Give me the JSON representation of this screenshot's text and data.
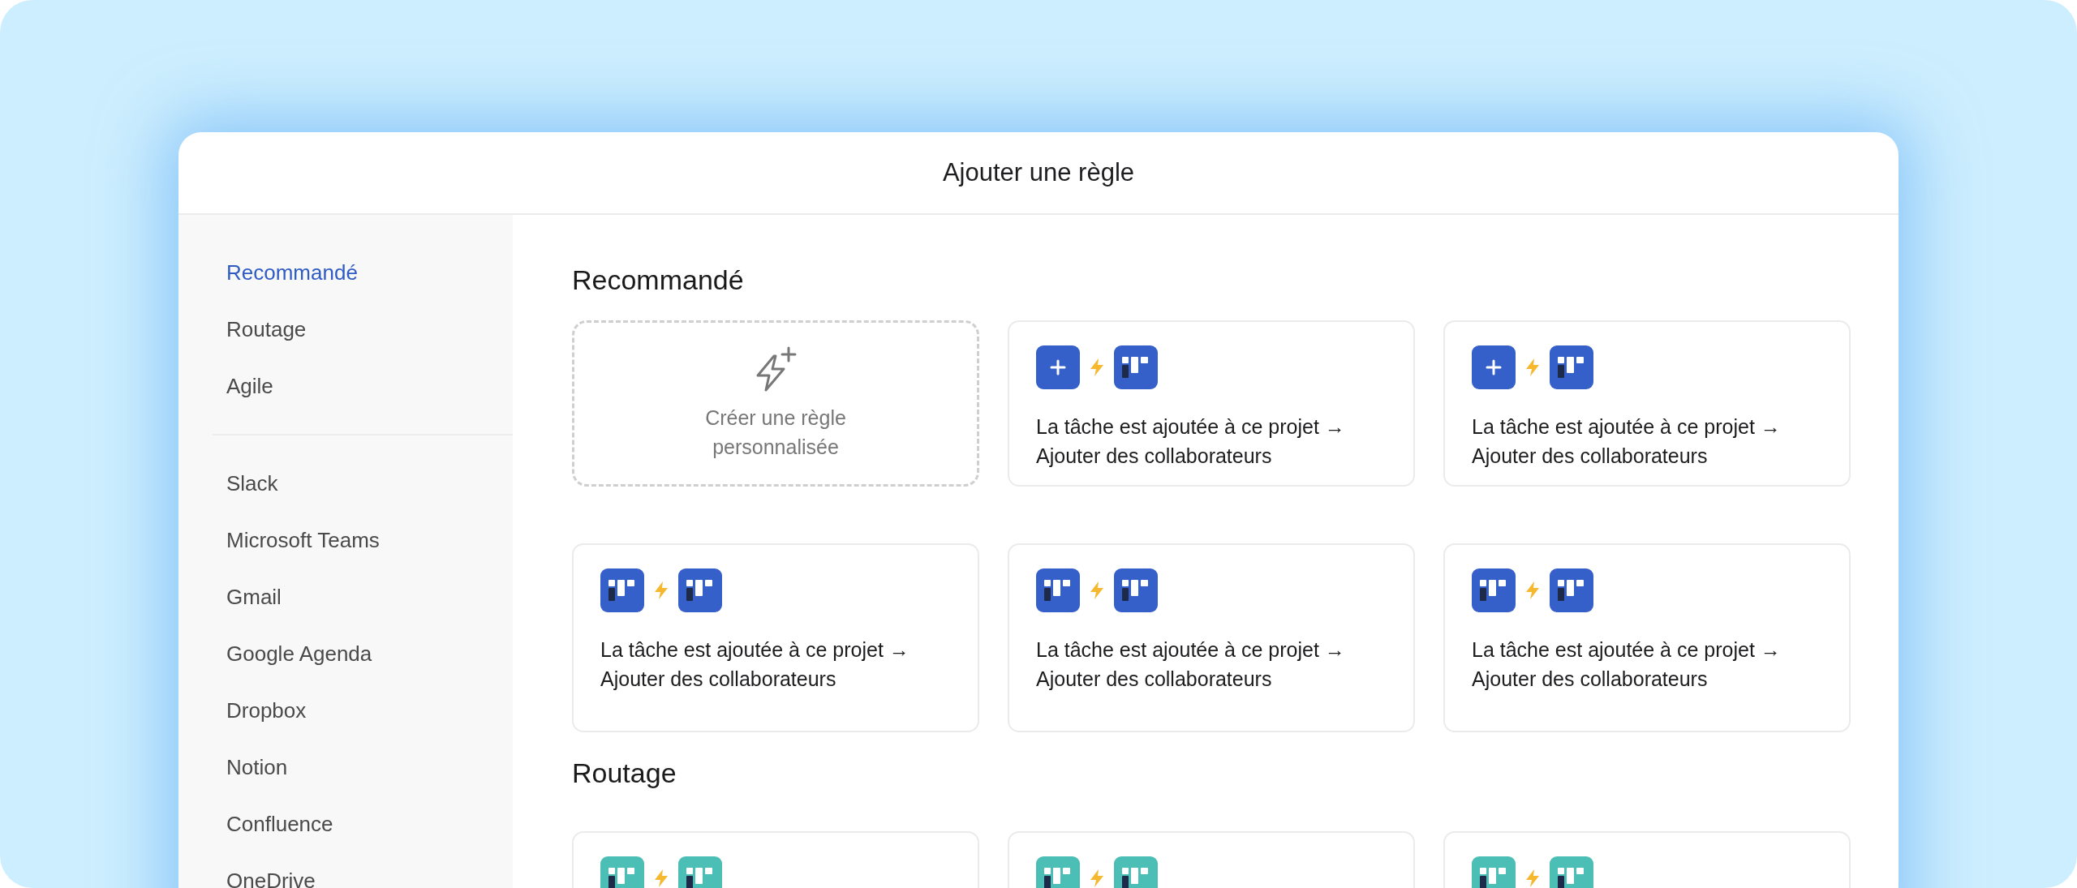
{
  "dialog": {
    "title": "Ajouter une règle"
  },
  "sidebar": {
    "groups": [
      {
        "items": [
          {
            "label": "Recommandé",
            "selected": true
          },
          {
            "label": "Routage",
            "selected": false
          },
          {
            "label": "Agile",
            "selected": false
          }
        ]
      },
      {
        "items": [
          {
            "label": "Slack",
            "selected": false
          },
          {
            "label": "Microsoft Teams",
            "selected": false
          },
          {
            "label": "Gmail",
            "selected": false
          },
          {
            "label": "Google Agenda",
            "selected": false
          },
          {
            "label": "Dropbox",
            "selected": false
          },
          {
            "label": "Notion",
            "selected": false
          },
          {
            "label": "Confluence",
            "selected": false
          },
          {
            "label": "OneDrive",
            "selected": false
          }
        ]
      }
    ]
  },
  "sections": [
    {
      "title": "Recommandé",
      "rows": [
        [
          {
            "kind": "custom",
            "label": "Créer une règle personnalisée"
          },
          {
            "kind": "rule",
            "icons": [
              {
                "kind": "plus"
              },
              {
                "kind": "board"
              }
            ],
            "color": "#3560c9",
            "trigger": "La tâche est ajoutée à ce projet →",
            "action": "Ajouter des collaborateurs"
          },
          {
            "kind": "rule",
            "icons": [
              {
                "kind": "plus"
              },
              {
                "kind": "board"
              }
            ],
            "color": "#3560c9",
            "trigger": "La tâche est ajoutée à ce projet →",
            "action": "Ajouter des collaborateurs"
          }
        ],
        [
          {
            "kind": "rule",
            "icons": [
              {
                "kind": "board"
              },
              {
                "kind": "board"
              }
            ],
            "color": "#3560c9",
            "trigger": "La tâche est ajoutée à ce projet →",
            "action": "Ajouter des collaborateurs"
          },
          {
            "kind": "rule",
            "icons": [
              {
                "kind": "board"
              },
              {
                "kind": "board"
              }
            ],
            "color": "#3560c9",
            "trigger": "La tâche est ajoutée à ce projet →",
            "action": "Ajouter des collaborateurs"
          },
          {
            "kind": "rule",
            "icons": [
              {
                "kind": "board"
              },
              {
                "kind": "board"
              }
            ],
            "color": "#3560c9",
            "trigger": "La tâche est ajoutée à ce projet →",
            "action": "Ajouter des collaborateurs"
          }
        ]
      ]
    },
    {
      "title": "Routage",
      "rows": [
        [
          {
            "kind": "rule",
            "icons": [
              {
                "kind": "board"
              },
              {
                "kind": "board"
              }
            ],
            "color": "#4bbfb5"
          },
          {
            "kind": "rule",
            "icons": [
              {
                "kind": "board"
              },
              {
                "kind": "board"
              }
            ],
            "color": "#4bbfb5"
          },
          {
            "kind": "rule",
            "icons": [
              {
                "kind": "board"
              },
              {
                "kind": "board"
              }
            ],
            "color": "#4bbfb5"
          }
        ]
      ]
    }
  ]
}
